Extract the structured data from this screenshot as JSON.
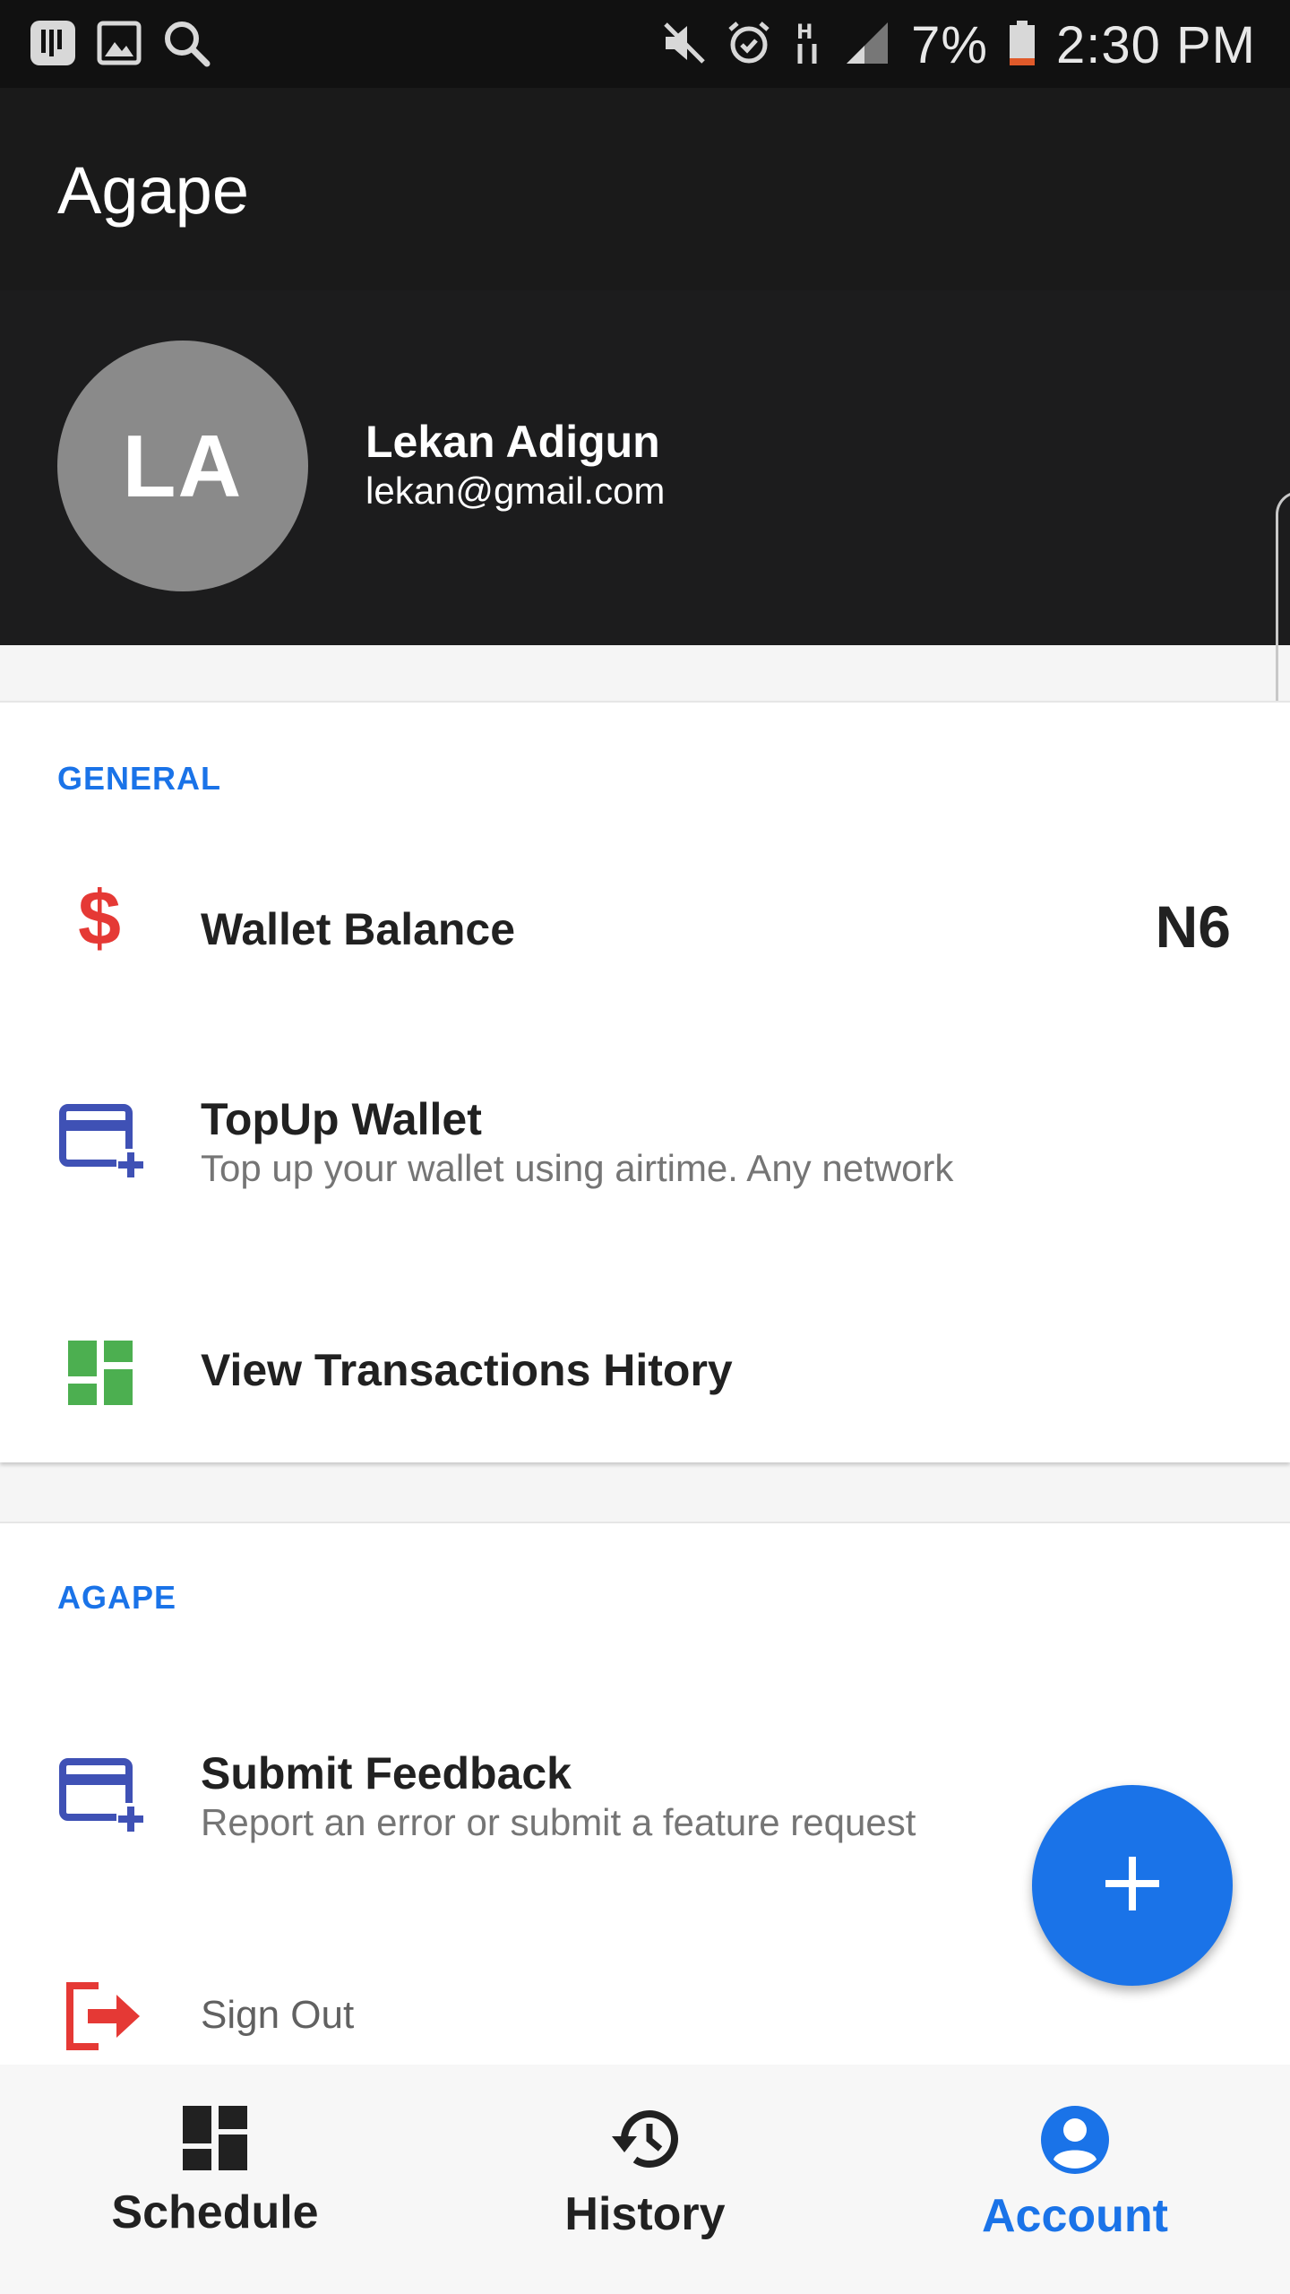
{
  "status_bar": {
    "battery": "7%",
    "time": "2:30 PM",
    "icons": [
      "gallery-icon",
      "image-icon",
      "search-icon",
      "mute-icon",
      "alarm-icon",
      "data-arrows-icon",
      "signal-icon",
      "battery-icon"
    ]
  },
  "app_bar": {
    "title": "Agape"
  },
  "profile": {
    "initials": "LA",
    "name": "Lekan Adigun",
    "email": "lekan@gmail.com"
  },
  "general": {
    "label": "GENERAL",
    "items": [
      {
        "title": "Wallet Balance",
        "value": "N6",
        "icon": "dollar-icon"
      },
      {
        "title": "TopUp Wallet",
        "subtitle": "Top up your wallet using airtime. Any network",
        "icon": "credit-card-add-icon"
      },
      {
        "title": "View Transactions Hitory",
        "icon": "dashboard-icon"
      }
    ]
  },
  "agape": {
    "label": "AGAPE",
    "items": [
      {
        "title": "Submit Feedback",
        "subtitle": "Report an error or submit a feature request",
        "icon": "credit-card-add-icon"
      },
      {
        "title": "Sign Out",
        "icon": "exit-icon"
      }
    ]
  },
  "fab": {
    "icon": "plus-icon"
  },
  "bottom_nav": {
    "items": [
      {
        "label": "Schedule",
        "icon": "dashboard-icon",
        "active": false
      },
      {
        "label": "History",
        "icon": "history-icon",
        "active": false
      },
      {
        "label": "Account",
        "icon": "account-circle-icon",
        "active": true
      }
    ]
  },
  "colors": {
    "accent": "#1a73e8",
    "dollar": "#e53935",
    "card_icon": "#3f51b5",
    "dashboard_green": "#4caf50",
    "sign_out": "#e53935",
    "dark_header": "#1a1a1a"
  }
}
